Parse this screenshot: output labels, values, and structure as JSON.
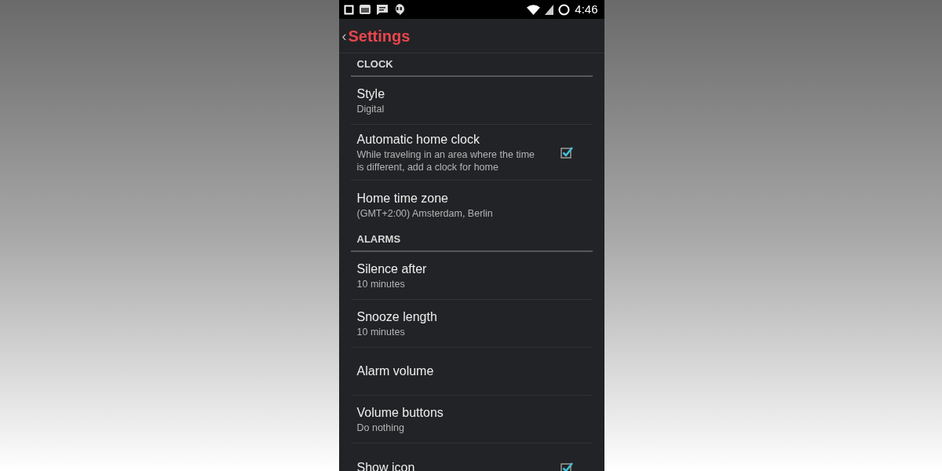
{
  "status_bar": {
    "time": "4:46"
  },
  "toolbar": {
    "back": "‹",
    "title": "Settings"
  },
  "sections": [
    {
      "title": "CLOCK",
      "items": [
        {
          "kind": "plain",
          "title": "Style",
          "summary": "Digital"
        },
        {
          "kind": "checkbox",
          "title": "Automatic home clock",
          "summary": "While traveling in an area where the time is different, add a clock for home",
          "checked": true
        },
        {
          "kind": "plain",
          "title": "Home time zone",
          "summary": "(GMT+2:00) Amsterdam, Berlin"
        }
      ]
    },
    {
      "title": "ALARMS",
      "items": [
        {
          "kind": "plain",
          "title": "Silence after",
          "summary": "10 minutes"
        },
        {
          "kind": "plain",
          "title": "Snooze length",
          "summary": "10 minutes"
        },
        {
          "kind": "plain",
          "title": "Alarm volume"
        },
        {
          "kind": "plain",
          "title": "Volume buttons",
          "summary": "Do nothing"
        },
        {
          "kind": "checkbox",
          "title": "Show icon",
          "checked": true
        }
      ]
    }
  ]
}
